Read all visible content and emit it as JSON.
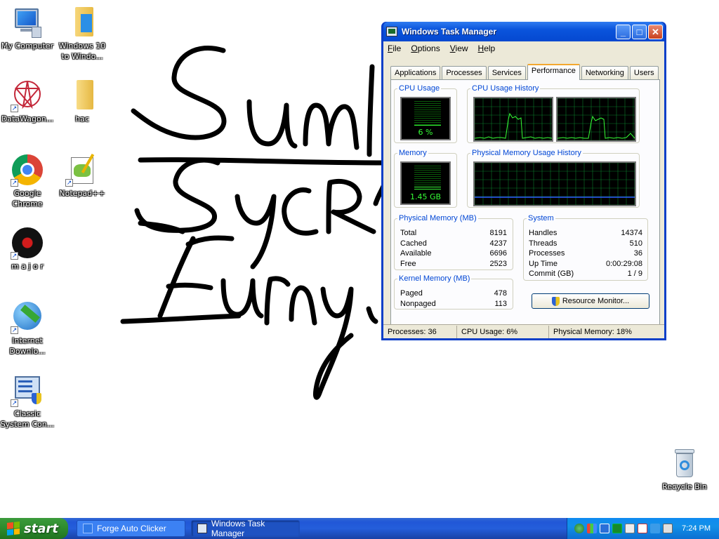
{
  "desktop": {
    "icons": [
      {
        "label": "My Computer",
        "icon": "my-computer-icon"
      },
      {
        "label": "Windows 10 to Windo...",
        "icon": "folder-icon"
      },
      {
        "label": "DataWagon...",
        "icon": "datawagon-icon"
      },
      {
        "label": "hac",
        "icon": "folder-icon"
      },
      {
        "label": "Google Chrome",
        "icon": "chrome-icon"
      },
      {
        "label": "Notepad++",
        "icon": "notepad-plus-plus-icon"
      },
      {
        "label": "m a j o r",
        "icon": "music-disc-icon"
      },
      {
        "label": "Internet Downlo...",
        "icon": "internet-download-manager-icon"
      },
      {
        "label": "Classic System Con...",
        "icon": "system-config-icon"
      },
      {
        "label": "Recycle Bin",
        "icon": "recycle-bin-icon"
      }
    ]
  },
  "task_manager": {
    "title": "Windows Task Manager",
    "menu": [
      "File",
      "Options",
      "View",
      "Help"
    ],
    "tabs": [
      "Applications",
      "Processes",
      "Services",
      "Performance",
      "Networking",
      "Users"
    ],
    "active_tab": "Performance",
    "cpu_usage": {
      "label": "CPU Usage",
      "value_text": "6 %",
      "percent": 6
    },
    "cpu_history": {
      "label": "CPU Usage History"
    },
    "memory": {
      "label": "Memory",
      "value_text": "1.45 GB",
      "fraction": 0.18
    },
    "memory_history": {
      "label": "Physical Memory Usage History"
    },
    "physical_memory": {
      "label": "Physical Memory (MB)",
      "rows": [
        {
          "name": "Total",
          "value": "8191"
        },
        {
          "name": "Cached",
          "value": "4237"
        },
        {
          "name": "Available",
          "value": "6696"
        },
        {
          "name": "Free",
          "value": "2523"
        }
      ]
    },
    "system": {
      "label": "System",
      "rows": [
        {
          "name": "Handles",
          "value": "14374"
        },
        {
          "name": "Threads",
          "value": "510"
        },
        {
          "name": "Processes",
          "value": "36"
        },
        {
          "name": "Up Time",
          "value": "0:00:29:08"
        },
        {
          "name": "Commit (GB)",
          "value": "1 / 9"
        }
      ]
    },
    "kernel_memory": {
      "label": "Kernel Memory (MB)",
      "rows": [
        {
          "name": "Paged",
          "value": "478"
        },
        {
          "name": "Nonpaged",
          "value": "113"
        }
      ]
    },
    "resource_monitor_button": "Resource Monitor...",
    "statusbar": {
      "processes": "Processes: 36",
      "cpu": "CPU Usage: 6%",
      "memory": "Physical Memory: 18%"
    }
  },
  "taskbar": {
    "start_label": "start",
    "tasks": [
      {
        "label": "Forge Auto Clicker",
        "active": false
      },
      {
        "label": "Windows Task Manager",
        "active": true
      }
    ],
    "clock": "7:24 PM"
  },
  "colors": {
    "graph_line": "#36ff36",
    "graph_grid": "#0b7a2a",
    "memory_line": "#2d5bff",
    "titlebar": "#0a54dc",
    "start_green": "#2d8b2d"
  }
}
